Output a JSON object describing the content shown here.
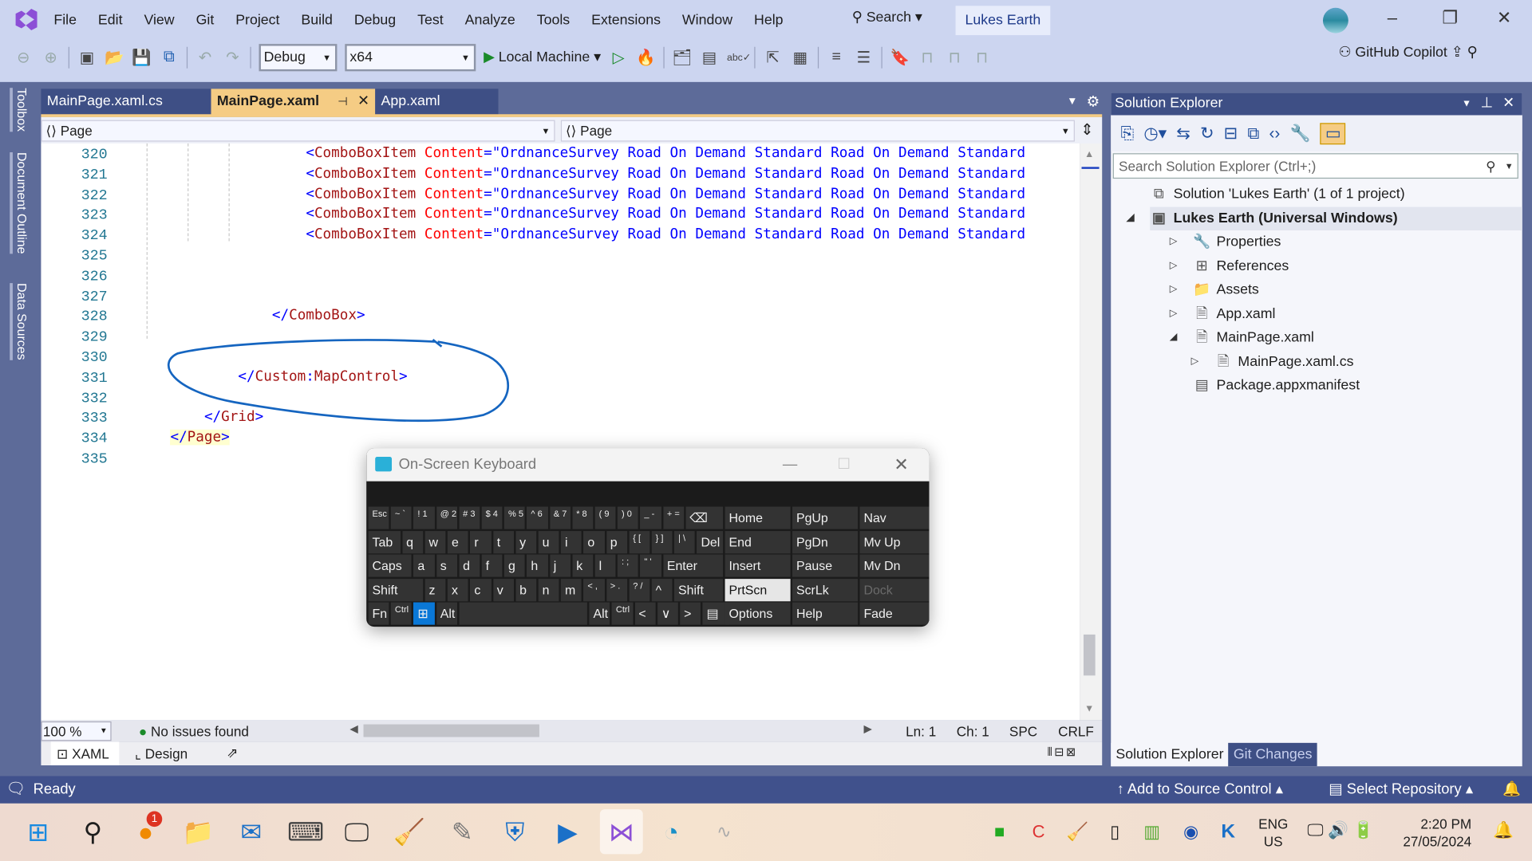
{
  "menu": [
    "File",
    "Edit",
    "View",
    "Git",
    "Project",
    "Build",
    "Debug",
    "Test",
    "Analyze",
    "Tools",
    "Extensions",
    "Window",
    "Help"
  ],
  "search_label": "Search",
  "solution_name": "Lukes Earth",
  "toolbar": {
    "config": "Debug",
    "platform": "x64",
    "run_target": "Local Machine",
    "copilot": "GitHub Copilot"
  },
  "side_tabs": [
    "Toolbox",
    "Document Outline",
    "Data Sources"
  ],
  "editor_tabs": [
    {
      "label": "MainPage.xaml.cs",
      "active": false
    },
    {
      "label": "MainPage.xaml",
      "active": true
    },
    {
      "label": "App.xaml",
      "active": false
    }
  ],
  "nav": {
    "left": "Page",
    "right": "Page"
  },
  "code_lines": [
    {
      "n": "320",
      "indent": 31,
      "segs": [
        [
          "b",
          "<"
        ],
        [
          "m",
          "ComboBoxItem"
        ],
        [
          "r",
          " Content"
        ],
        [
          "b",
          "=\"OrdnanceSurvey Road On Demand Standard Road On Demand Standard"
        ]
      ]
    },
    {
      "n": "321",
      "indent": 31,
      "segs": [
        [
          "b",
          "<"
        ],
        [
          "m",
          "ComboBoxItem"
        ],
        [
          "r",
          " Content"
        ],
        [
          "b",
          "=\"OrdnanceSurvey Road On Demand Standard Road On Demand Standard"
        ]
      ]
    },
    {
      "n": "322",
      "indent": 31,
      "segs": [
        [
          "b",
          "<"
        ],
        [
          "m",
          "ComboBoxItem"
        ],
        [
          "r",
          " Content"
        ],
        [
          "b",
          "=\"OrdnanceSurvey Road On Demand Standard Road On Demand Standard"
        ]
      ]
    },
    {
      "n": "323",
      "indent": 31,
      "segs": [
        [
          "b",
          "<"
        ],
        [
          "m",
          "ComboBoxItem"
        ],
        [
          "r",
          " Content"
        ],
        [
          "b",
          "=\"OrdnanceSurvey Road On Demand Standard Road On Demand Standard"
        ]
      ]
    },
    {
      "n": "324",
      "indent": 31,
      "segs": [
        [
          "b",
          "<"
        ],
        [
          "m",
          "ComboBoxItem"
        ],
        [
          "r",
          " Content"
        ],
        [
          "b",
          "=\"OrdnanceSurvey Road On Demand Standard Road On Demand Standard"
        ]
      ]
    },
    {
      "n": "325",
      "indent": 0,
      "segs": []
    },
    {
      "n": "326",
      "indent": 0,
      "segs": []
    },
    {
      "n": "327",
      "indent": 0,
      "segs": []
    },
    {
      "n": "328",
      "indent": 27,
      "segs": [
        [
          "b",
          "</"
        ],
        [
          "m",
          "ComboBox"
        ],
        [
          "b",
          ">"
        ]
      ]
    },
    {
      "n": "329",
      "indent": 0,
      "segs": []
    },
    {
      "n": "330",
      "indent": 0,
      "segs": []
    },
    {
      "n": "331",
      "indent": 23,
      "segs": [
        [
          "b",
          "</"
        ],
        [
          "m",
          "Custom"
        ],
        [
          "b",
          ":"
        ],
        [
          "m",
          "MapControl"
        ],
        [
          "b",
          ">"
        ]
      ]
    },
    {
      "n": "332",
      "indent": 0,
      "segs": []
    },
    {
      "n": "333",
      "indent": 19,
      "segs": [
        [
          "b",
          "</"
        ],
        [
          "m",
          "Grid"
        ],
        [
          "b",
          ">"
        ]
      ]
    },
    {
      "n": "334",
      "indent": 15,
      "segs": [
        [
          "b",
          "</"
        ],
        [
          "m",
          "Page"
        ],
        [
          "b",
          ">"
        ]
      ]
    },
    {
      "n": "335",
      "indent": 0,
      "segs": []
    }
  ],
  "status": {
    "zoom": "100 %",
    "issues": "No issues found",
    "ln": "Ln: 1",
    "ch": "Ch: 1",
    "spc": "SPC",
    "crlf": "CRLF"
  },
  "view_tabs": {
    "xaml": "XAML",
    "design": "Design"
  },
  "solution_explorer": {
    "title": "Solution Explorer",
    "search_placeholder": "Search Solution Explorer (Ctrl+;)",
    "items": [
      {
        "label": "Solution 'Lukes Earth' (1 of 1 project)",
        "icon": "solution-icon",
        "level": 0,
        "expander": ""
      },
      {
        "label": "Lukes Earth (Universal Windows)",
        "icon": "csharp-project-icon",
        "level": 0,
        "expander": "◢",
        "bold": true
      },
      {
        "label": "Properties",
        "icon": "wrench-icon",
        "level": 1,
        "expander": "▷"
      },
      {
        "label": "References",
        "icon": "references-icon",
        "level": 1,
        "expander": "▷"
      },
      {
        "label": "Assets",
        "icon": "folder-icon",
        "level": 1,
        "expander": "▷"
      },
      {
        "label": "App.xaml",
        "icon": "xaml-file-icon",
        "level": 1,
        "expander": "▷"
      },
      {
        "label": "MainPage.xaml",
        "icon": "xaml-file-icon",
        "level": 1,
        "expander": "◢"
      },
      {
        "label": "MainPage.xaml.cs",
        "icon": "cs-file-icon",
        "level": 2,
        "expander": "▷"
      },
      {
        "label": "Package.appxmanifest",
        "icon": "manifest-icon",
        "level": 1,
        "expander": ""
      }
    ],
    "bottom_tabs": [
      "Solution Explorer",
      "Git Changes"
    ]
  },
  "statusbar": {
    "ready": "Ready",
    "source_control": "Add to Source Control",
    "repository": "Select Repository"
  },
  "osk": {
    "title": "On-Screen Keyboard",
    "rows": [
      [
        [
          "Esc",
          1,
          "s"
        ],
        [
          "~ `",
          1,
          "s"
        ],
        [
          "! 1",
          1,
          "s"
        ],
        [
          "@ 2",
          1,
          "s"
        ],
        [
          "# 3",
          1,
          "s"
        ],
        [
          "$ 4",
          1,
          "s"
        ],
        [
          "% 5",
          1,
          "s"
        ],
        [
          "^ 6",
          1,
          "s"
        ],
        [
          "& 7",
          1,
          "s"
        ],
        [
          "* 8",
          1,
          "s"
        ],
        [
          "( 9",
          1,
          "s"
        ],
        [
          ") 0",
          1,
          "s"
        ],
        [
          "_ -",
          1,
          "s"
        ],
        [
          "+ =",
          1,
          "s"
        ],
        [
          "⌫",
          1.75,
          ""
        ]
      ],
      [
        [
          "Tab",
          1.5,
          ""
        ],
        [
          "q",
          1,
          ""
        ],
        [
          "w",
          1,
          ""
        ],
        [
          "e",
          1,
          ""
        ],
        [
          "r",
          1,
          ""
        ],
        [
          "t",
          1,
          ""
        ],
        [
          "y",
          1,
          ""
        ],
        [
          "u",
          1,
          ""
        ],
        [
          "i",
          1,
          ""
        ],
        [
          "o",
          1,
          ""
        ],
        [
          "p",
          1,
          ""
        ],
        [
          "{ [",
          1,
          "s"
        ],
        [
          "} ]",
          1,
          "s"
        ],
        [
          "| \\",
          1,
          "s"
        ],
        [
          "Del",
          1.25,
          ""
        ]
      ],
      [
        [
          "Caps",
          2,
          ""
        ],
        [
          "a",
          1,
          ""
        ],
        [
          "s",
          1,
          ""
        ],
        [
          "d",
          1,
          ""
        ],
        [
          "f",
          1,
          ""
        ],
        [
          "g",
          1,
          ""
        ],
        [
          "h",
          1,
          ""
        ],
        [
          "j",
          1,
          ""
        ],
        [
          "k",
          1,
          ""
        ],
        [
          "l",
          1,
          ""
        ],
        [
          ": ;",
          1,
          "s"
        ],
        [
          "\" '",
          1,
          "s"
        ],
        [
          "Enter",
          2.75,
          ""
        ]
      ],
      [
        [
          "Shift",
          2.5,
          ""
        ],
        [
          "z",
          1,
          ""
        ],
        [
          "x",
          1,
          ""
        ],
        [
          "c",
          1,
          ""
        ],
        [
          "v",
          1,
          ""
        ],
        [
          "b",
          1,
          ""
        ],
        [
          "n",
          1,
          ""
        ],
        [
          "m",
          1,
          ""
        ],
        [
          "< ,",
          1,
          "s"
        ],
        [
          "> .",
          1,
          "s"
        ],
        [
          "? /",
          1,
          "s"
        ],
        [
          "^",
          1,
          ""
        ],
        [
          "Shift",
          2.25,
          ""
        ]
      ],
      [
        [
          "Fn",
          1,
          ""
        ],
        [
          "Ctrl",
          1,
          "s"
        ],
        [
          "⊞",
          1,
          "w"
        ],
        [
          "Alt",
          1,
          ""
        ],
        [
          " ",
          5.75,
          ""
        ],
        [
          "Alt",
          1,
          ""
        ],
        [
          "Ctrl",
          1,
          "s"
        ],
        [
          "<",
          1,
          ""
        ],
        [
          "∨",
          1,
          ""
        ],
        [
          ">",
          1,
          ""
        ],
        [
          "▤",
          1.25,
          ""
        ]
      ]
    ],
    "side_keys": [
      [
        "Home",
        "PgUp",
        "Nav"
      ],
      [
        "End",
        "PgDn",
        "Mv Up"
      ],
      [
        "Insert",
        "Pause",
        "Mv Dn"
      ],
      [
        "PrtScn",
        "ScrLk",
        "Dock"
      ],
      [
        "Options",
        "Help",
        "Fade"
      ]
    ]
  },
  "taskbar": {
    "mail_badge": "1",
    "lang1": "ENG",
    "lang2": "US",
    "time": "2:20 PM",
    "date": "27/05/2024"
  },
  "colors": {
    "accent": "#5d6b99",
    "active_tab": "#f5cc84",
    "statusbar": "#40518c",
    "annotation": "#1565c0"
  }
}
